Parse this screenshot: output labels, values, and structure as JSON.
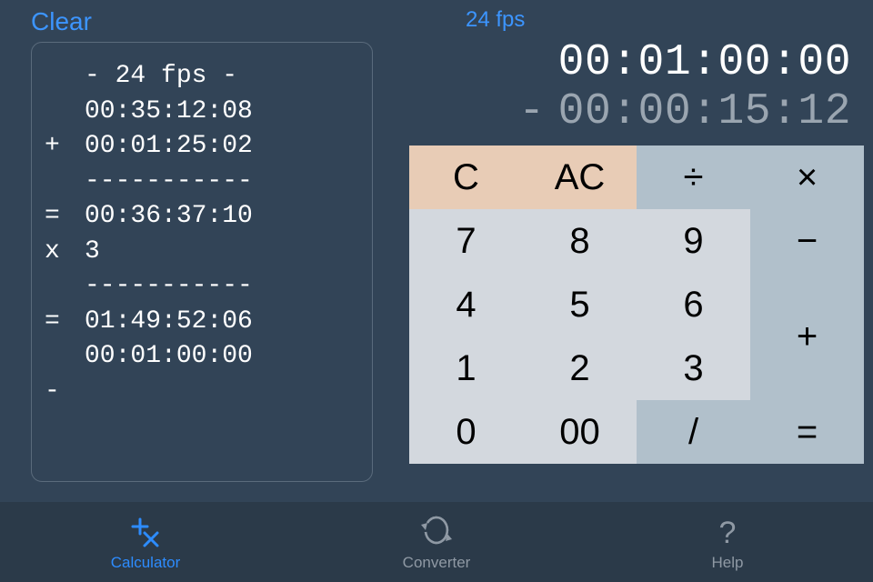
{
  "left": {
    "clear_label": "Clear",
    "tape": [
      {
        "op": "",
        "val": "- 24 fps -"
      },
      {
        "op": "",
        "val": ""
      },
      {
        "op": "",
        "val": "00:35:12:08"
      },
      {
        "op": "+",
        "val": "00:01:25:02"
      },
      {
        "op": "",
        "val": "-----------"
      },
      {
        "op": "=",
        "val": "00:36:37:10"
      },
      {
        "op": "x",
        "val": "3"
      },
      {
        "op": "",
        "val": "-----------"
      },
      {
        "op": "=",
        "val": "01:49:52:06"
      },
      {
        "op": "",
        "val": ""
      },
      {
        "op": "",
        "val": "00:01:00:00"
      },
      {
        "op": "-",
        "val": ""
      }
    ]
  },
  "display": {
    "fps_label": "24 fps",
    "main": "00:01:00:00",
    "sub_sign": "-",
    "sub": "00:00:15:12"
  },
  "keys": {
    "c": "C",
    "ac": "AC",
    "div": "÷",
    "mul": "×",
    "k7": "7",
    "k8": "8",
    "k9": "9",
    "sub": "−",
    "k4": "4",
    "k5": "5",
    "k6": "6",
    "add": "+",
    "k1": "1",
    "k2": "2",
    "k3": "3",
    "eq": "=",
    "k0": "0",
    "k00": "00",
    "slash": "/"
  },
  "tabs": {
    "calculator": "Calculator",
    "converter": "Converter",
    "help": "Help"
  },
  "colors": {
    "bg": "#324457",
    "accent": "#2d8cff",
    "tan": "#e8ccb6",
    "slate": "#b1c0cb",
    "pale": "#d3d8de"
  }
}
